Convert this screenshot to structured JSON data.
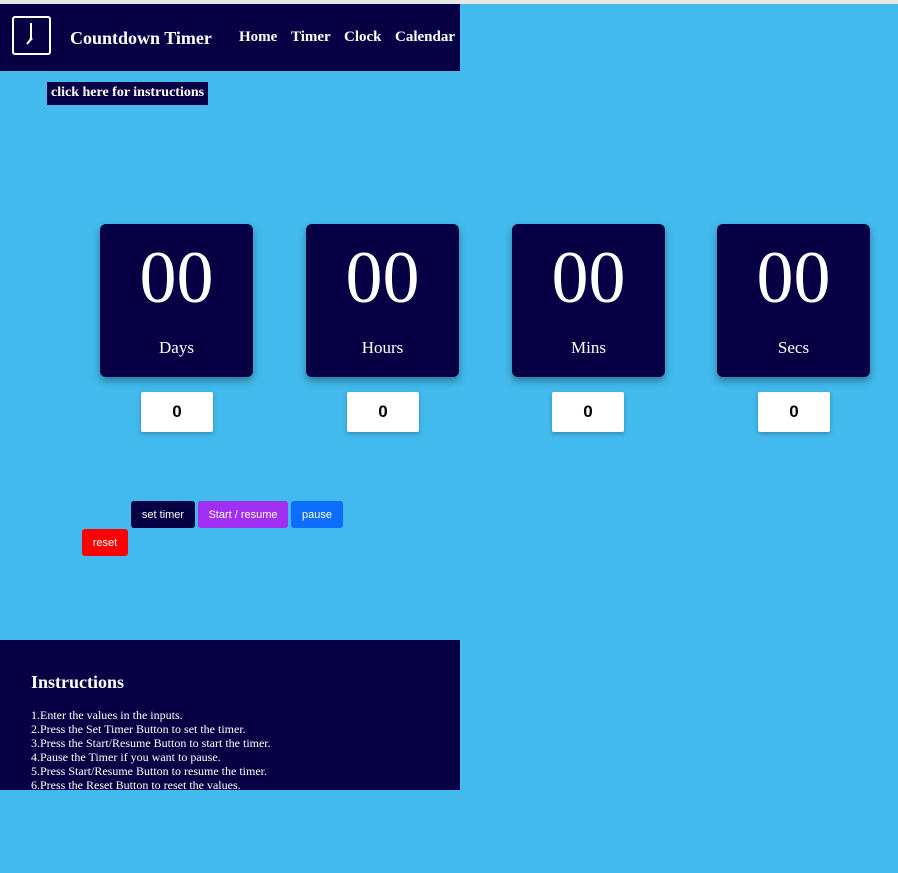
{
  "header": {
    "brand": "Countdown Timer",
    "nav": [
      "Home",
      "Timer",
      "Clock",
      "Calendar"
    ]
  },
  "instructions_link": "click here for instructions",
  "timer": {
    "units": [
      {
        "value": "00",
        "label": "Days",
        "input": "0"
      },
      {
        "value": "00",
        "label": "Hours",
        "input": "0"
      },
      {
        "value": "00",
        "label": "Mins",
        "input": "0"
      },
      {
        "value": "00",
        "label": "Secs",
        "input": "0"
      }
    ]
  },
  "buttons": {
    "set": "set timer",
    "start": "Start / resume",
    "pause": "pause",
    "reset": "reset"
  },
  "instructions": {
    "title": "Instructions",
    "steps": [
      "1.Enter the values in the inputs.",
      "2.Press the Set Timer Button to set the timer.",
      "3.Press the Start/Resume Button to start the timer.",
      "4.Pause the Timer if you want to pause.",
      "5.Press Start/Resume Button to resume the timer.",
      "6.Press the Reset Button to reset the values."
    ]
  },
  "colors": {
    "background": "#42baed",
    "navy": "#080044",
    "set_button": "#080044",
    "start_button": "#a12ff2",
    "pause_button": "#0d6efd",
    "reset_button": "#ff0000"
  }
}
